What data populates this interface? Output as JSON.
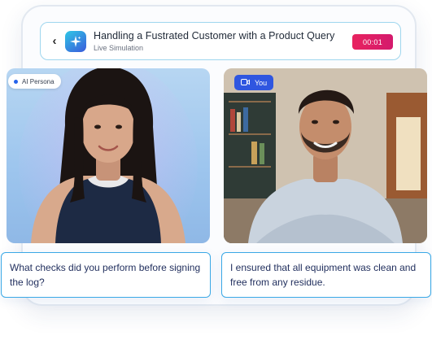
{
  "header": {
    "title": "Handling a Fustrated Customer with a Product Query",
    "subtitle": "Live Simulation",
    "timer": "00:01",
    "back_icon": "chevron-left-icon",
    "app_icon": "sparkle-icon"
  },
  "panels": {
    "ai": {
      "tag": "AI Persona"
    },
    "user": {
      "tag": "You"
    }
  },
  "captions": {
    "ai": "What checks did you perform before signing the log?",
    "user": "I ensured that all equipment was clean and free from any residue."
  },
  "colors": {
    "accent": "#2f56e0",
    "timer": "#e8235f",
    "caption_border": "#3aa8e6",
    "header_border": "#9fd6ee"
  }
}
